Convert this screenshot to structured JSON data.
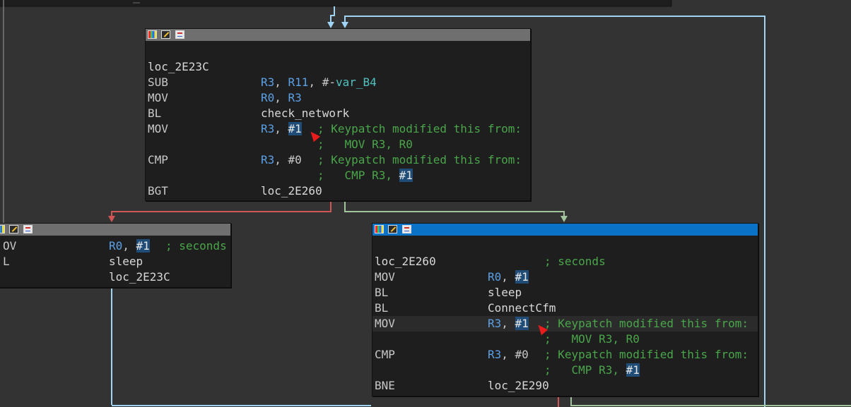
{
  "colors": {
    "background": "#333333",
    "block_bg": "#1e1e1e",
    "titlebar_inactive": "#6f6f6f",
    "titlebar_active": "#0a73c8",
    "edge_blue": "#9fd4f4",
    "edge_red": "#d05555",
    "edge_green": "#a2c49a",
    "comment": "#4aa64a",
    "register": "#5ca0e6",
    "highlight": "#1f4d78"
  },
  "blocks": {
    "top": {
      "label": "loc_2E23C",
      "lines": [
        {
          "mnemonic": "SUB",
          "reg1": "R3",
          "sep1": ", ",
          "reg2": "R11",
          "sep2": ", #-",
          "var": "var_B4"
        },
        {
          "mnemonic": "MOV",
          "reg1": "R0",
          "sep1": ", ",
          "reg2": "R3"
        },
        {
          "mnemonic": "BL",
          "target": "check_network"
        },
        {
          "mnemonic": "MOV",
          "reg1": "R3",
          "sep1": ", ",
          "imm": "#1",
          "comment": "; Keypatch modified this from:"
        },
        {
          "comment": ";   MOV R3, R0"
        },
        {
          "mnemonic": "CMP",
          "reg1": "R3",
          "sep1": ", ",
          "imm": "#0",
          "comment": "; Keypatch modified this from:"
        },
        {
          "comment_prefix": ";   CMP R3, ",
          "comment_imm": "#1"
        },
        {
          "mnemonic": "BGT",
          "target": "loc_2E260"
        }
      ]
    },
    "left": {
      "lines": [
        {
          "mnemonic": "OV",
          "reg1": "R0",
          "sep1": ", ",
          "imm": "#1",
          "comment": "; seconds"
        },
        {
          "mnemonic": "L",
          "target": "sleep"
        },
        {
          "target": "loc_2E23C"
        }
      ]
    },
    "right": {
      "label": "loc_2E260",
      "label_comment": "; seconds",
      "lines": [
        {
          "mnemonic": "MOV",
          "reg1": "R0",
          "sep1": ", ",
          "imm": "#1"
        },
        {
          "mnemonic": "BL",
          "target": "sleep"
        },
        {
          "mnemonic": "BL",
          "target": "ConnectCfm"
        },
        {
          "mnemonic": "MOV",
          "reg1": "R3",
          "sep1": ", ",
          "imm": "#1",
          "comment": "; Keypatch modified this from:"
        },
        {
          "comment": ";   MOV R3, R0"
        },
        {
          "mnemonic": "CMP",
          "reg1": "R3",
          "sep1": ", ",
          "imm": "#0",
          "comment": "; Keypatch modified this from:"
        },
        {
          "comment_prefix": ";   CMP R3, ",
          "comment_imm": "#1"
        },
        {
          "mnemonic": "BNE",
          "target": "loc_2E290"
        }
      ]
    }
  }
}
